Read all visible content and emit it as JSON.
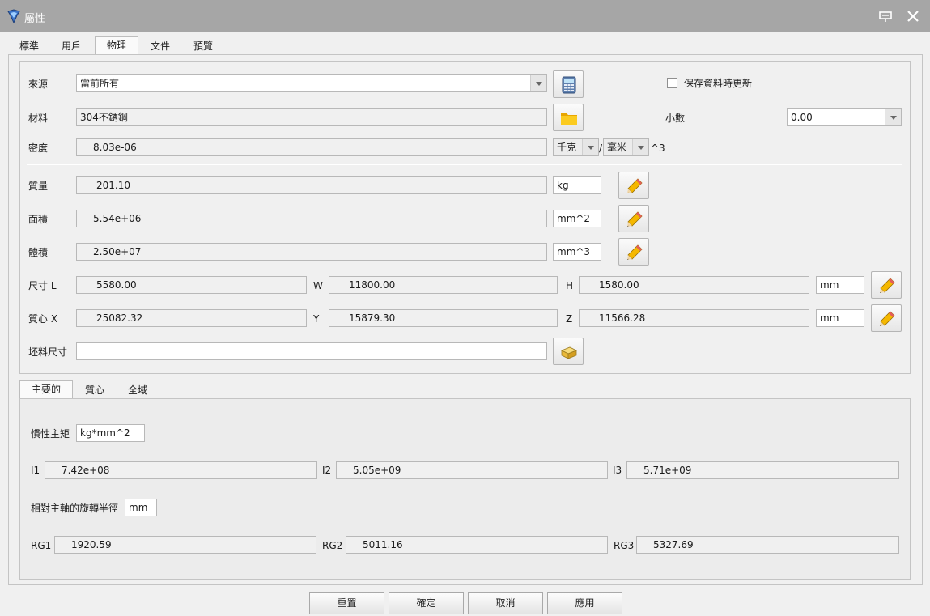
{
  "window": {
    "title": "屬性"
  },
  "tabs": [
    "標準",
    "用戶",
    "物理",
    "文件",
    "預覽"
  ],
  "source": {
    "label": "來源",
    "value": "當前所有"
  },
  "save_update": {
    "label": "保存資料時更新"
  },
  "material": {
    "label": "材料",
    "value": "304不銹鋼"
  },
  "decimal": {
    "label": "小數",
    "value": "0.00"
  },
  "density": {
    "label": "密度",
    "value": "8.03e-06",
    "unit1": "千克",
    "slash": "/",
    "unit2": "毫米",
    "power": "^3"
  },
  "mass": {
    "label": "質量",
    "value": "201.10",
    "unit": "kg"
  },
  "area": {
    "label": "面積",
    "value": "5.54e+06",
    "unit": "mm^2"
  },
  "volume": {
    "label": "體積",
    "value": "2.50e+07",
    "unit": "mm^3"
  },
  "dims": {
    "label": "尺寸  L",
    "l": "5580.00",
    "w_label": "W",
    "w": "11800.00",
    "h_label": "H",
    "h": "1580.00",
    "unit": "mm"
  },
  "centroid": {
    "label": "質心  X",
    "x": "25082.32",
    "y_label": "Y",
    "y": "15879.30",
    "z_label": "Z",
    "z": "11566.28",
    "unit": "mm"
  },
  "blank": {
    "label": "坯料尺寸",
    "value": ""
  },
  "subtabs": [
    "主要的",
    "質心",
    "全域"
  ],
  "inertia": {
    "label": "慣性主矩",
    "unit": "kg*mm^2",
    "i1_label": "I1",
    "i1": "7.42e+08",
    "i2_label": "I2",
    "i2": "5.05e+09",
    "i3_label": "I3",
    "i3": "5.71e+09"
  },
  "gyration": {
    "label": "相對主軸的旋轉半徑",
    "unit": "mm",
    "rg1_label": "RG1",
    "rg1": "1920.59",
    "rg2_label": "RG2",
    "rg2": "5011.16",
    "rg3_label": "RG3",
    "rg3": "5327.69"
  },
  "buttons": {
    "reset": "重置",
    "ok": "確定",
    "cancel": "取消",
    "apply": "應用"
  }
}
